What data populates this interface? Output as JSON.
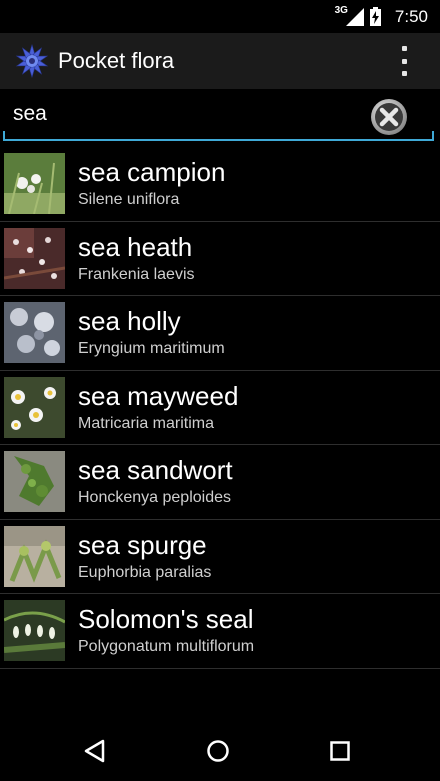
{
  "status_bar": {
    "network": "3G",
    "time": "7:50",
    "icons": [
      "signal-icon",
      "battery-charging-icon"
    ]
  },
  "app": {
    "title": "Pocket flora",
    "logo_icon": "cornflower-icon",
    "overflow_icon": "more-vert-icon"
  },
  "search": {
    "value": "sea",
    "clear_icon": "clear-icon",
    "accent": "#3fa9d6"
  },
  "results": [
    {
      "name": "sea campion",
      "latin": "Silene uniflora"
    },
    {
      "name": "sea heath",
      "latin": "Frankenia laevis"
    },
    {
      "name": "sea holly",
      "latin": "Eryngium maritimum"
    },
    {
      "name": "sea mayweed",
      "latin": "Matricaria maritima"
    },
    {
      "name": "sea sandwort",
      "latin": "Honckenya peploides"
    },
    {
      "name": "sea spurge",
      "latin": "Euphorbia paralias"
    },
    {
      "name": "Solomon's seal",
      "latin": "Polygonatum multiflorum"
    }
  ],
  "nav": {
    "back_icon": "back-icon",
    "home_icon": "home-icon",
    "recent_icon": "recent-apps-icon"
  }
}
